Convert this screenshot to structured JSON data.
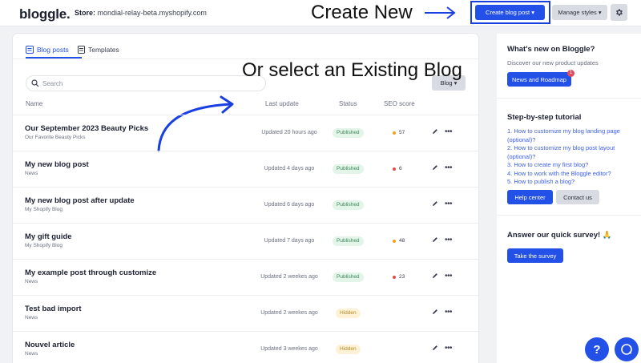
{
  "header": {
    "logo": "bloggle.",
    "store_label": "Store:",
    "store_value": "mondial-relay-beta.myshopify.com",
    "annotation": "Create New",
    "create_button": "Create blog post",
    "manage_button": "Manage styles",
    "settings_icon": "gear-icon"
  },
  "main": {
    "tabs": [
      {
        "label": "Blog posts",
        "icon": "blog-icon",
        "active": true
      },
      {
        "label": "Templates",
        "icon": "template-icon",
        "active": false
      }
    ],
    "search": {
      "placeholder": "Search"
    },
    "filter_button": "Blog",
    "annotation": "Or select an Existing Blog",
    "columns": {
      "name": "Name",
      "last_update": "Last update",
      "status": "Status",
      "seo": "SEO score"
    },
    "rows": [
      {
        "title": "Our September 2023 Beauty Picks",
        "blog": "Our Favorite Beauty Picks",
        "updated": "Updated 20 hours ago",
        "status": "Published",
        "seo": "57",
        "seo_color": "#f0a21b"
      },
      {
        "title": "My new blog post",
        "blog": "News",
        "updated": "Updated 4 days ago",
        "status": "Published",
        "seo": "6",
        "seo_color": "#e24b4b"
      },
      {
        "title": "My new blog post after update",
        "blog": "My Shopify Blog",
        "updated": "Updated 6 days ago",
        "status": "Published",
        "seo": "",
        "seo_color": ""
      },
      {
        "title": "My gift guide",
        "blog": "My Shopify Blog",
        "updated": "Updated 7 days ago",
        "status": "Published",
        "seo": "48",
        "seo_color": "#f0a21b"
      },
      {
        "title": "My example post through customize",
        "blog": "News",
        "updated": "Updated 2 weekes ago",
        "status": "Published",
        "seo": "23",
        "seo_color": "#e24b4b"
      },
      {
        "title": "Test bad import",
        "blog": "News",
        "updated": "Updated 2 weekes ago",
        "status": "Hidden",
        "seo": "",
        "seo_color": ""
      },
      {
        "title": "Nouvel article",
        "blog": "News",
        "updated": "Updated 3 weekes ago",
        "status": "Hidden",
        "seo": "",
        "seo_color": ""
      }
    ]
  },
  "sidebar": {
    "whats_new": {
      "title": "What's new on Bloggle?",
      "text": "Discover our new product updates",
      "button": "News and Roadmap",
      "badge": "1"
    },
    "tutorial": {
      "title": "Step-by-step tutorial",
      "links": [
        "1. How to customize my blog landing page (optional)?",
        "2. How to customize my blog post layout (optional)?",
        "3. How to create my first blog?",
        "4. How to work with the Bloggle editor?",
        "5. How to publish a blog?"
      ],
      "help_button": "Help center",
      "contact_button": "Contact us"
    },
    "survey": {
      "title": "Answer our quick survey! 🙏",
      "button": "Take the survey"
    }
  },
  "colors": {
    "accent": "#2350e6",
    "published_bg": "#e3f4e9",
    "hidden_bg": "#fdf2d6"
  }
}
